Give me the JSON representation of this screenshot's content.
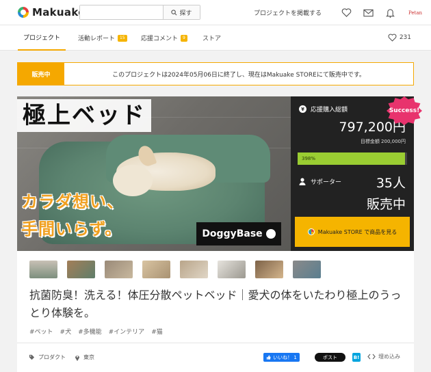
{
  "header": {
    "logo_text": "Makuake",
    "search_placeholder": "",
    "search_button": "探す",
    "post_project": "プロジェクトを掲載する",
    "avatar_text": "Petan"
  },
  "tabs": {
    "project": "プロジェクト",
    "report": "活動レポート",
    "report_badge": "15",
    "comments": "応援コメント",
    "comments_badge": "9",
    "store": "ストア",
    "favorites_count": "231"
  },
  "notice": {
    "label": "販売中",
    "text": "このプロジェクトは2024年05月06日に終了し、現在はMakuake STOREにて販売中です。"
  },
  "hero": {
    "title": "極上ベッド",
    "sub1": "カラダ想い、",
    "sub2": "手間いらず。",
    "brand": "DoggyBase"
  },
  "stats": {
    "success_badge": "Success!",
    "total_label": "応援購入総額",
    "yen_icon": "¥",
    "amount": "797,200円",
    "target": "目標金額 200,000円",
    "percent_label": "398%",
    "percent_value": 0.98,
    "supporters_label": "サポーター",
    "supporters_count": "35人",
    "status": "販売中",
    "store_button": "Makuake STORE で商品を見る"
  },
  "thumbnails": [
    "thumb-1",
    "thumb-2",
    "thumb-3",
    "thumb-4",
    "thumb-5",
    "thumb-6",
    "thumb-7",
    "thumb-8"
  ],
  "title": "抗菌防臭！洗える！体圧分散ペットベッド｜愛犬の体をいたわり極上のうっとり体験を。",
  "tags": [
    "#ペット",
    "#犬",
    "#多機能",
    "#インテリア",
    "#猫"
  ],
  "meta": {
    "category": "プロダクト",
    "location": "東京"
  },
  "share": {
    "like": "いいね！ 1",
    "post": "ポスト",
    "hatena": "B!",
    "embed": "埋め込み"
  },
  "colors": {
    "accent": "#f5a800",
    "success": "#e8336d",
    "progress": "#9acd32",
    "facebook": "#1877f2"
  }
}
